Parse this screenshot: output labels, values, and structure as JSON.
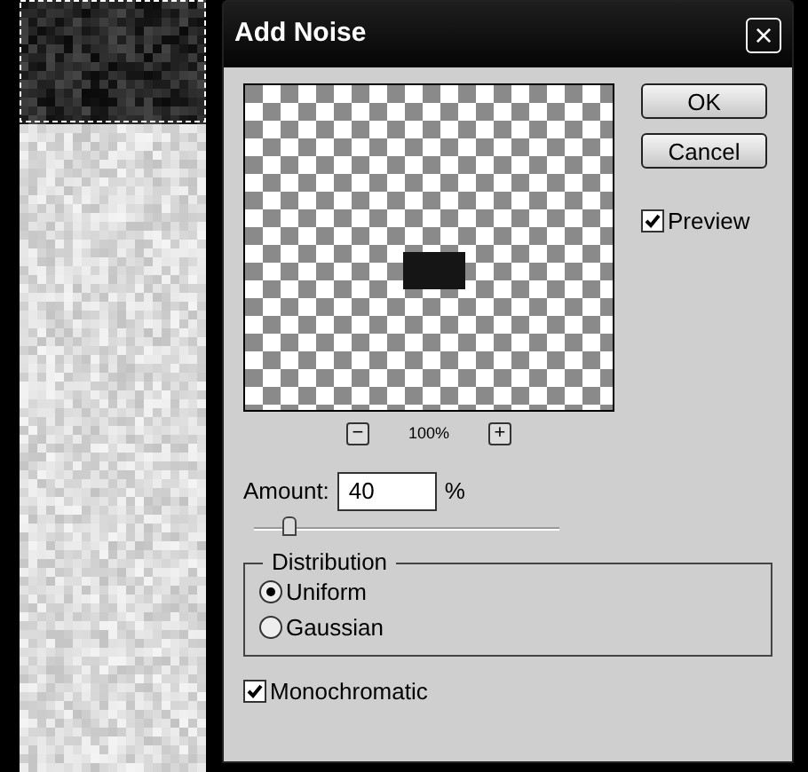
{
  "window": {
    "title": "Add Noise",
    "close": "×"
  },
  "buttons": [
    {
      "label": "OK"
    },
    {
      "label": "Cancel"
    }
  ],
  "preview": {
    "label": "Preview",
    "checked": true
  },
  "zoom": {
    "minus": "−",
    "value": "100%",
    "plus": "+"
  },
  "amount": {
    "label": "Amount:",
    "value": "40",
    "unit": "%",
    "level": 0.1
  },
  "distribution": {
    "title": "Distribution",
    "options": [
      {
        "label": "Uniform",
        "selected": true
      },
      {
        "label": "Gaussian",
        "selected": false
      }
    ]
  },
  "monochromatic": {
    "label": "Monochromatic",
    "checked": true
  }
}
